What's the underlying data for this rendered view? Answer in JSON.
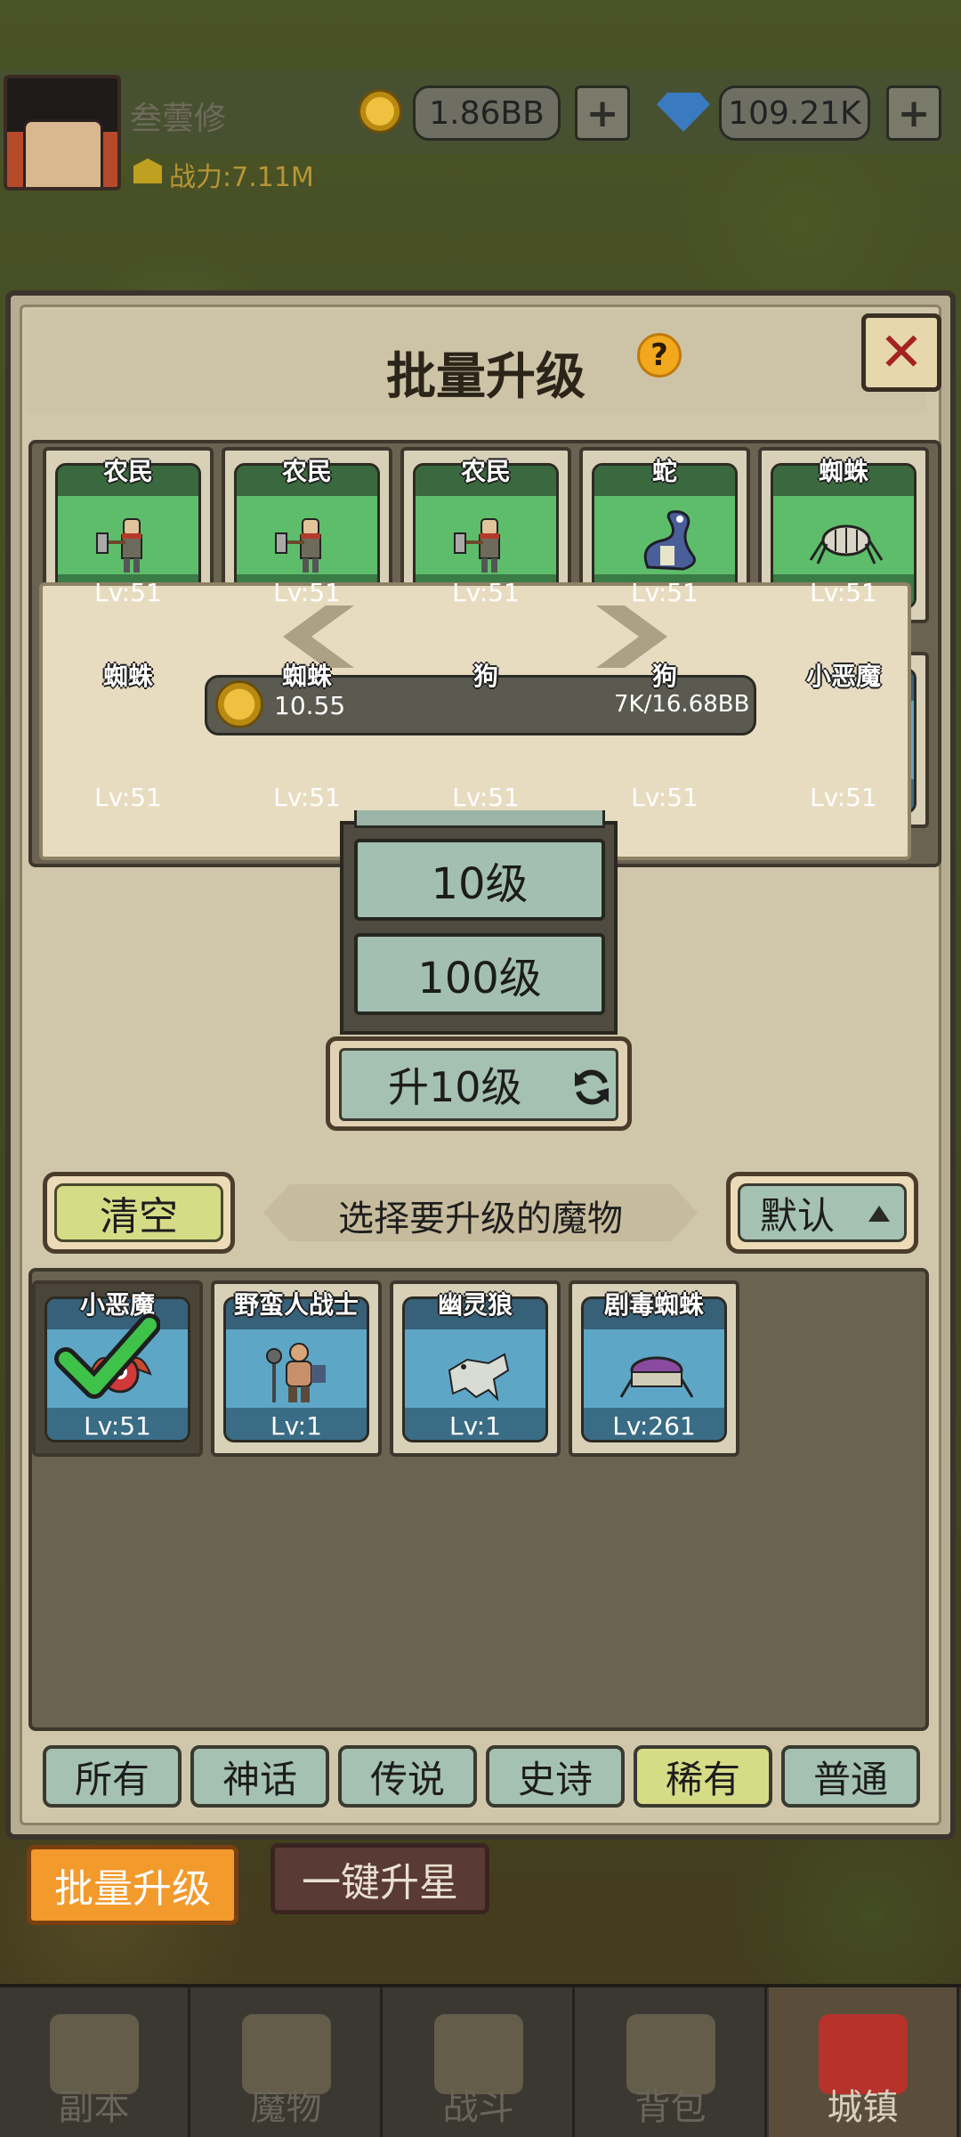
{
  "player": {
    "name": "叁蕓修",
    "power": "战力:7.11M"
  },
  "resources": {
    "gold": "1.86BB",
    "gems": "109.21K",
    "plus": "+"
  },
  "modal": {
    "title": "批量升级",
    "help": "?",
    "close": "✕"
  },
  "selected": [
    {
      "name": "农民",
      "level": "Lv:51",
      "rarity": "green",
      "icon": "peasant-icon"
    },
    {
      "name": "农民",
      "level": "Lv:51",
      "rarity": "green",
      "icon": "peasant-icon"
    },
    {
      "name": "农民",
      "level": "Lv:51",
      "rarity": "green",
      "icon": "peasant-icon"
    },
    {
      "name": "蛇",
      "level": "Lv:51",
      "rarity": "green",
      "icon": "snake-icon"
    },
    {
      "name": "蜘蛛",
      "level": "Lv:51",
      "rarity": "green",
      "icon": "spider-icon"
    },
    {
      "name": "蜘蛛",
      "level": "Lv:51",
      "rarity": "green",
      "icon": "spider-icon"
    },
    {
      "name": "蜘蛛",
      "level": "Lv:51",
      "rarity": "green",
      "icon": "spider-icon"
    },
    {
      "name": "狗",
      "level": "Lv:51",
      "rarity": "green",
      "icon": "dog-icon"
    },
    {
      "name": "狗",
      "level": "Lv:51",
      "rarity": "green",
      "icon": "dog-icon"
    },
    {
      "name": "小恶魔",
      "level": "Lv:51",
      "rarity": "blue",
      "icon": "imp-icon"
    }
  ],
  "cost": {
    "left": "10.55",
    "right": "7K/16.68BB"
  },
  "dropdown": {
    "options": [
      "10级",
      "100级"
    ]
  },
  "upgrade_button": "升10级",
  "filters": {
    "clear": "清空",
    "hint": "选择要升级的魔物",
    "sort": "默认"
  },
  "available": [
    {
      "name": "小恶魔",
      "level": "Lv:51",
      "selected": true,
      "icon": "imp-icon"
    },
    {
      "name": "野蛮人战士",
      "level": "Lv:1",
      "selected": false,
      "icon": "barbarian-icon"
    },
    {
      "name": "幽灵狼",
      "level": "Lv:1",
      "selected": false,
      "icon": "ghost-wolf-icon"
    },
    {
      "name": "剧毒蜘蛛",
      "level": "Lv:261",
      "selected": false,
      "icon": "poison-spider-icon"
    }
  ],
  "rarity_tabs": [
    {
      "label": "所有",
      "active": false
    },
    {
      "label": "神话",
      "active": false
    },
    {
      "label": "传说",
      "active": false
    },
    {
      "label": "史诗",
      "active": false
    },
    {
      "label": "稀有",
      "active": true
    },
    {
      "label": "普通",
      "active": false
    }
  ],
  "actions": {
    "batch_upgrade": "批量升级",
    "one_key_star": "一键升星"
  },
  "nav": [
    {
      "label": "副本",
      "icon": "map-icon",
      "active": false
    },
    {
      "label": "魔物",
      "icon": "monster-icon",
      "active": false
    },
    {
      "label": "战斗",
      "icon": "swords-icon",
      "active": false
    },
    {
      "label": "背包",
      "icon": "backpack-icon",
      "active": false
    },
    {
      "label": "城镇",
      "icon": "town-icon",
      "active": true
    }
  ],
  "colors": {
    "common": "#5ebd6a",
    "rare": "#5ea6c6",
    "accent": "#f29a2c",
    "close": "#a32222"
  }
}
